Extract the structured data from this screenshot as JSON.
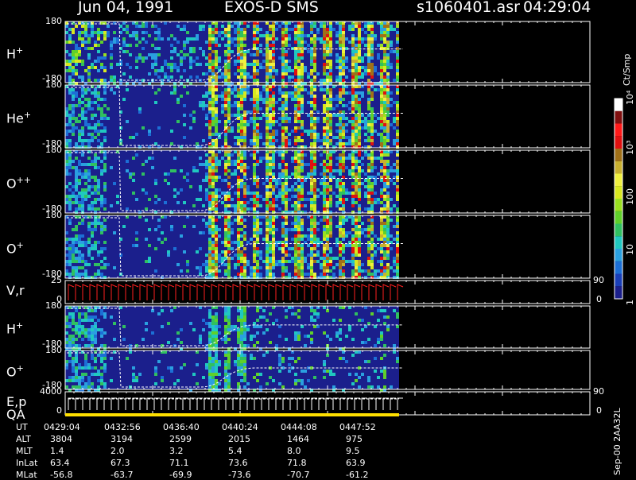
{
  "header": {
    "date": "Jun 04, 1991",
    "instrument": "EXOS-D SMS",
    "file": "s1060401.asr",
    "start_time": "04:29:04"
  },
  "panels": [
    {
      "label": "H",
      "sup": "+",
      "ytop": "180",
      "ybot": "-180"
    },
    {
      "label": "He",
      "sup": "+",
      "ytop": "180",
      "ybot": "-180"
    },
    {
      "label": "O",
      "sup": "++",
      "ytop": "180",
      "ybot": "-180"
    },
    {
      "label": "O",
      "sup": "+",
      "ytop": "180",
      "ybot": "-180"
    },
    {
      "label": "V,r",
      "sup": "",
      "ytop": "25",
      "ybot": "0",
      "rtop": "90",
      "rbot": "0"
    },
    {
      "label": "H",
      "sup": "+",
      "ytop": "180",
      "ybot": "-180"
    },
    {
      "label": "O",
      "sup": "+",
      "ytop": "180",
      "ybot": "-180"
    },
    {
      "label": "E,p",
      "label2": "QA",
      "sup": "",
      "ytop": "4000",
      "ybot": "0",
      "rtop": "90",
      "rbot": "0"
    }
  ],
  "colorbar": {
    "title": "Ct/Smp",
    "ticks": [
      {
        "label": "1",
        "v": 0
      },
      {
        "label": "10",
        "v": 1
      },
      {
        "label": "100",
        "v": 2
      },
      {
        "label": "10³",
        "v": 3
      },
      {
        "label": "10⁴",
        "v": 4
      }
    ],
    "colors": [
      "#1b1f8c",
      "#1a3fb8",
      "#1c6fd6",
      "#2aa0e0",
      "#20c8c0",
      "#30c060",
      "#5fd02a",
      "#9ae020",
      "#d8e820",
      "#f0f040",
      "#c8b030",
      "#a07018",
      "#e01010",
      "#ff1a1a",
      "#801010",
      "#ffffff"
    ]
  },
  "time_table": {
    "rows": [
      {
        "name": "UT",
        "vals": [
          "0429:04",
          "0432:56",
          "0436:40",
          "0440:24",
          "0444:08",
          "0447:52"
        ]
      },
      {
        "name": "ALT",
        "vals": [
          "3804",
          "3194",
          "2599",
          "2015",
          "1464",
          "975"
        ]
      },
      {
        "name": "MLT",
        "vals": [
          "1.4",
          "2.0",
          "3.2",
          "5.4",
          "8.0",
          "9.5"
        ]
      },
      {
        "name": "InLat",
        "vals": [
          "63.4",
          "67.3",
          "71.1",
          "73.6",
          "71.8",
          "63.9"
        ]
      },
      {
        "name": "MLat",
        "vals": [
          "-56.8",
          "-63.7",
          "-69.9",
          "-73.6",
          "-70.7",
          "-61.2"
        ]
      }
    ]
  },
  "footer_code": "Sep-00 2AA32L",
  "chart_data": {
    "type": "heatmap",
    "title": "Jun 04, 1991   EXOS-D SMS",
    "x_ticks": [
      "0429:04",
      "0432:56",
      "0436:40",
      "0440:24",
      "0444:08",
      "0447:52"
    ],
    "series": [
      {
        "name": "H+",
        "ylim": [
          -180,
          180
        ]
      },
      {
        "name": "He+",
        "ylim": [
          -180,
          180
        ]
      },
      {
        "name": "O++",
        "ylim": [
          -180,
          180
        ]
      },
      {
        "name": "O+",
        "ylim": [
          -180,
          180
        ]
      },
      {
        "name": "V,r",
        "ylim": [
          0,
          25
        ]
      },
      {
        "name": "H+",
        "ylim": [
          -180,
          180
        ]
      },
      {
        "name": "O+",
        "ylim": [
          -180,
          180
        ]
      },
      {
        "name": "E,p",
        "ylim": [
          0,
          4000
        ]
      }
    ],
    "colorbar_range": [
      1,
      10000
    ],
    "colorbar_unit": "Ct/Smp"
  }
}
